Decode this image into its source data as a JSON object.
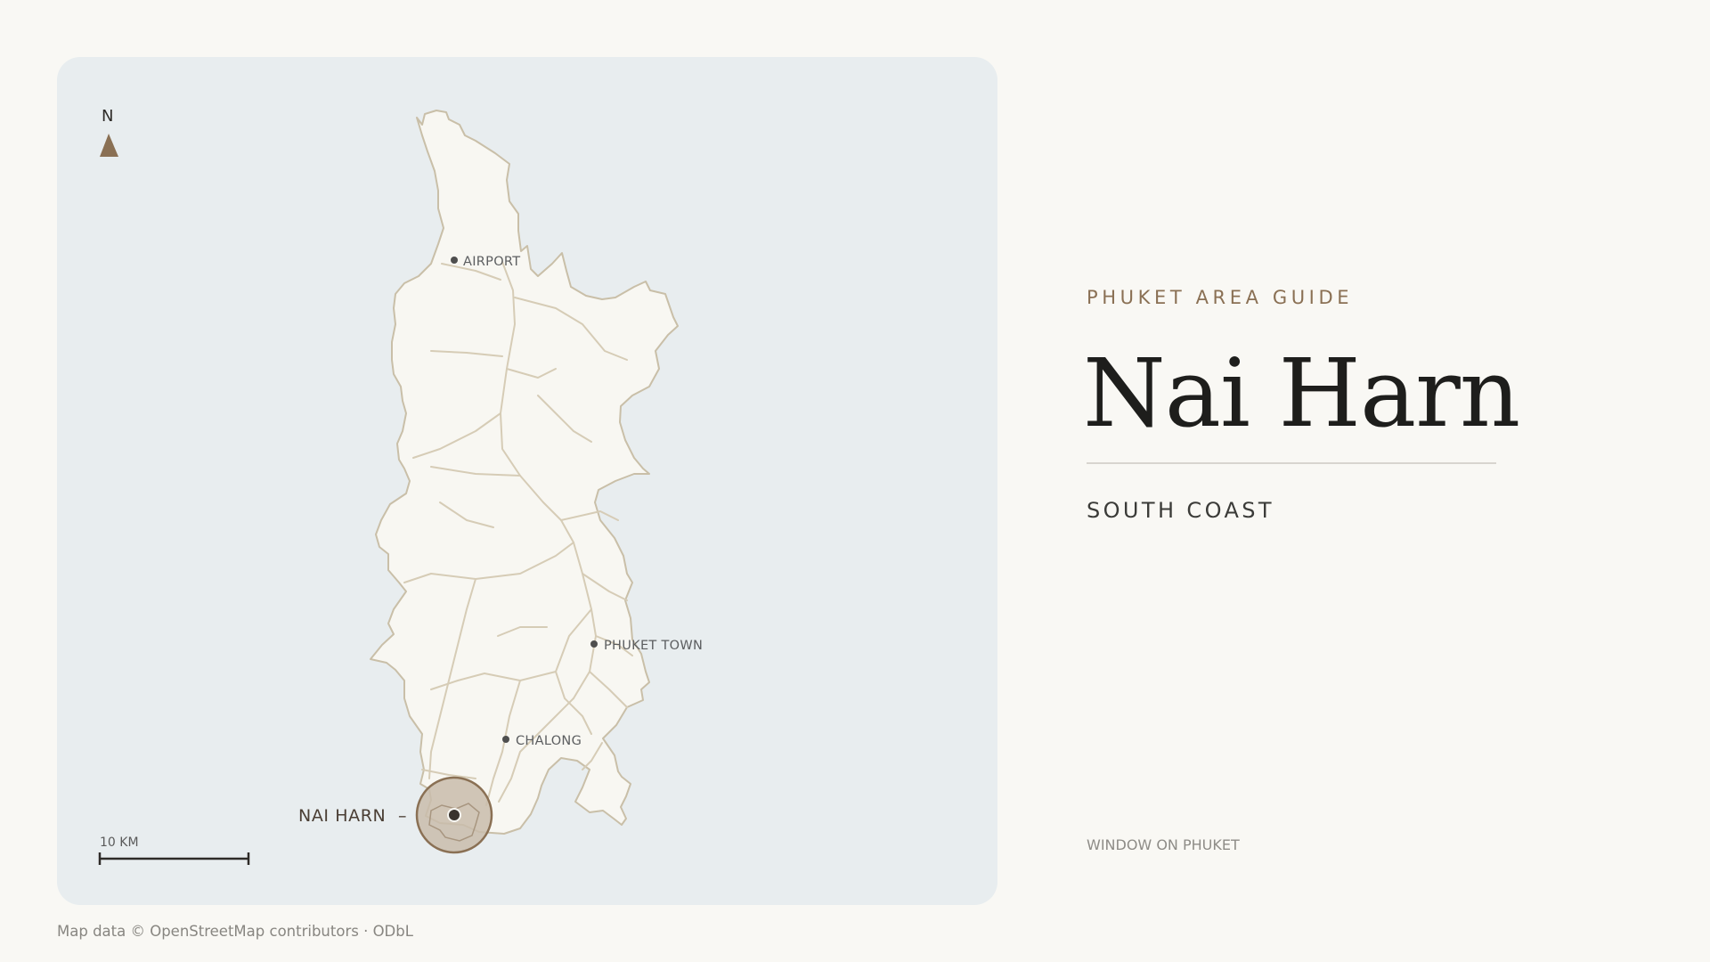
{
  "map": {
    "compass_label": "N",
    "scale_label": "10 KM",
    "places": [
      {
        "name": "AIRPORT"
      },
      {
        "name": "PHUKET TOWN"
      },
      {
        "name": "CHALONG"
      }
    ],
    "featured": {
      "name": "NAI HARN",
      "connector": "–"
    },
    "attribution": "Map data © OpenStreetMap contributors · ODbL",
    "colors": {
      "water": "#e8edef",
      "land": "#f8f7f2",
      "coastline": "#c9bfa8",
      "roads": "#d6ccb6",
      "accent": "#8a7054",
      "highlight_fill": "#c9bcab"
    }
  },
  "side": {
    "eyebrow": "PHUKET AREA GUIDE",
    "title": "Nai Harn",
    "subtitle": "SOUTH COAST",
    "brand": "WINDOW ON PHUKET"
  }
}
